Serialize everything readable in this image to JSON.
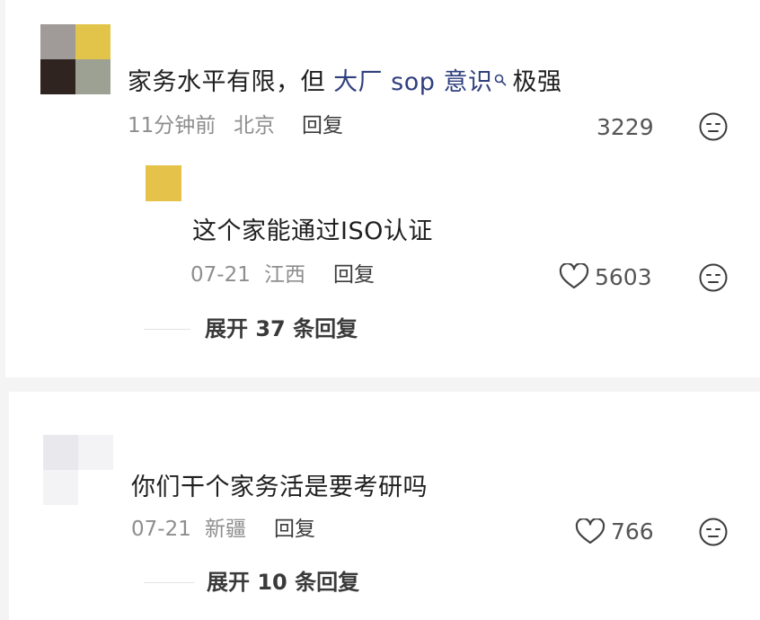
{
  "comments": [
    {
      "text_before": "家务水平有限，但 ",
      "highlight": "大厂 sop 意识",
      "text_after": "极强",
      "time": "11分钟前",
      "location": "北京",
      "reply_label": "回复",
      "likes": "3229",
      "avatar_colors": [
        "#a09a98",
        "#e3c44a",
        "#2f241f",
        "#9da193"
      ],
      "reply": {
        "text": "这个家能通过ISO认证",
        "time": "07-21",
        "location": "江西",
        "reply_label": "回复",
        "likes": "5603",
        "avatar_color": "#e5c249"
      },
      "expand_label": "展开 37 条回复"
    },
    {
      "text": "你们干个家务活是要考研吗",
      "time": "07-21",
      "location": "新疆",
      "reply_label": "回复",
      "likes": "766",
      "avatar_colors": [
        "#e8e8ed",
        "#f3f3f6",
        "#f3f3f6",
        "#ffffff"
      ],
      "expand_label": "展开 10 条回复"
    }
  ]
}
